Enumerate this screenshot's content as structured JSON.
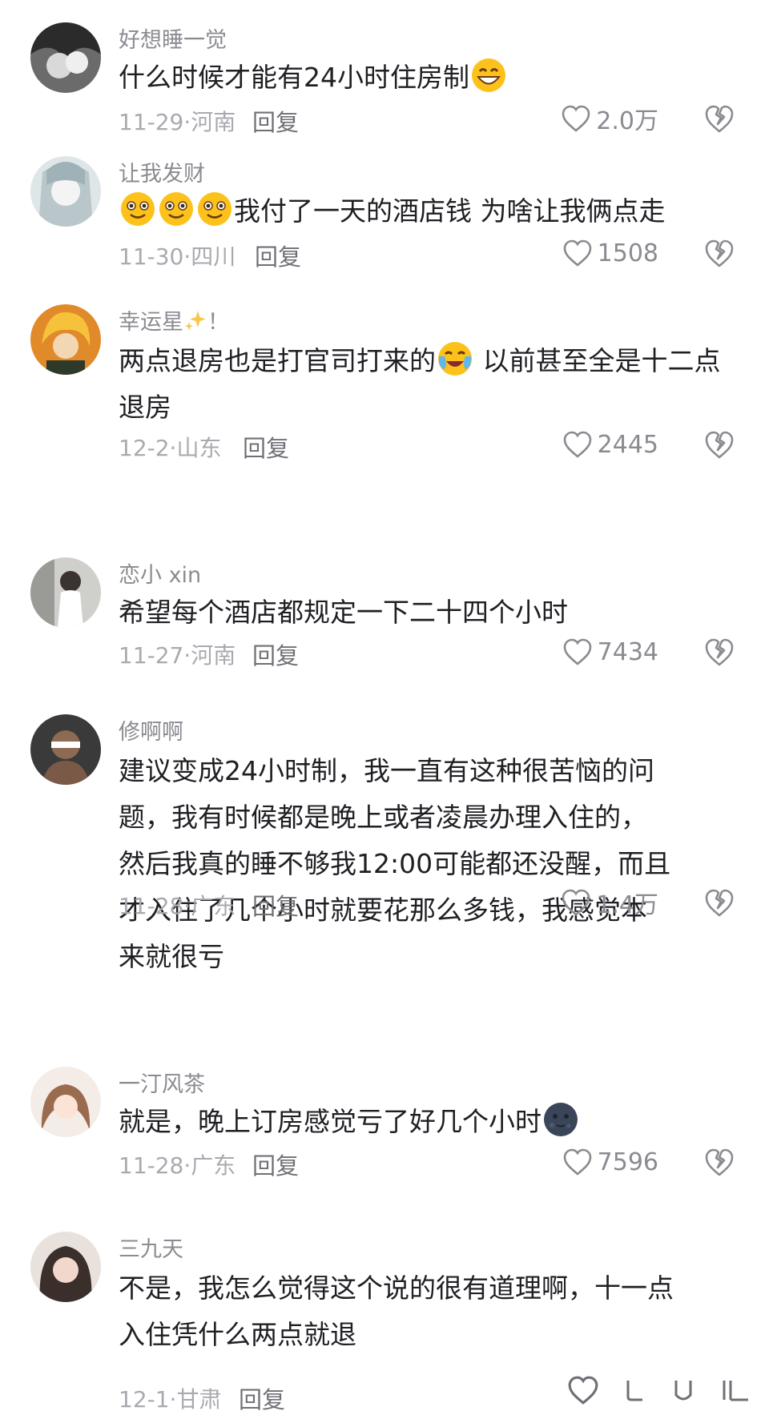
{
  "comments": [
    {
      "user": "好想睡一觉",
      "text_before": "什么时候才能有24小时住房制",
      "text_after": "",
      "emoji": "grin-emoji",
      "date_location": "11-29·河南",
      "reply": "回复",
      "likes": "2.0万"
    },
    {
      "user": "让我发财",
      "text_before": "",
      "text_after": "我付了一天的酒店钱 为啥让我俩点走",
      "emoji": "smile-emoji x3",
      "date_location": "11-30·四川",
      "reply": "回复",
      "likes": "1508"
    },
    {
      "user": "幸运星",
      "user_suffix": "！",
      "text_before": "两点退房也是打官司打来的",
      "text_after": " 以前甚至全是十二点退房",
      "emoji": "crying-laughing-emoji",
      "date_location": "12-2·山东",
      "reply": "回复",
      "likes": "2445"
    },
    {
      "user": "恋小 xin",
      "text": "希望每个酒店都规定一下二十四个小时",
      "date_location": "11-27·河南",
      "reply": "回复",
      "likes": "7434"
    },
    {
      "user": "修啊啊",
      "text": "建议变成24小时制，我一直有这种很苦恼的问题，我有时候都是晚上或者凌晨办理入住的，然后我真的睡不够我12:00可能都还没醒，而且才入住了几个小时就要花那么多钱，我感觉本来就很亏",
      "date_location": "11-28·广东",
      "reply": "回复",
      "likes": "1.4万"
    },
    {
      "user": "一汀风茶",
      "text_before": "就是，晚上订房感觉亏了好几个小时",
      "text_after": "",
      "emoji": "dark-moon-emoji",
      "date_location": "11-28·广东",
      "reply": "回复",
      "likes": "7596"
    },
    {
      "user": "三九天",
      "text": "不是，我怎么觉得这个说的很有道理啊，十一点入住凭什么两点就退",
      "date_location": "12-1·甘肃",
      "reply": "回复",
      "likes": ""
    }
  ],
  "colors": {
    "text": "#1f1f24",
    "meta": "#a9aab0",
    "username": "#8a8b91",
    "icon": "#8a8b91"
  }
}
